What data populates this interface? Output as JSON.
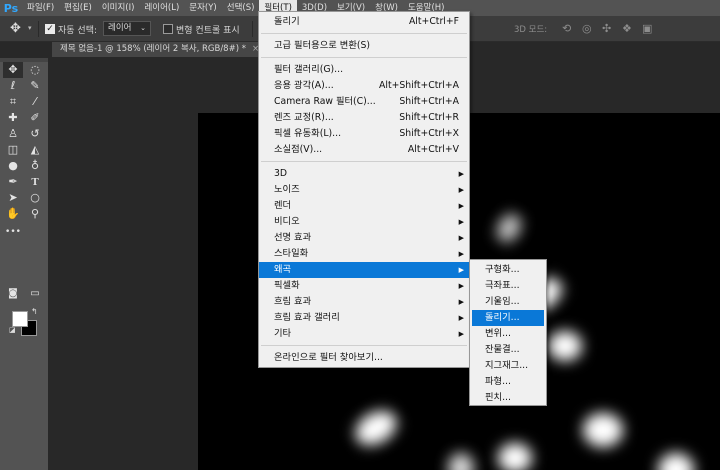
{
  "menubar": {
    "logo": "Ps",
    "items": [
      "파일(F)",
      "편집(E)",
      "이미지(I)",
      "레이어(L)",
      "문자(Y)",
      "선택(S)",
      "필터(T)",
      "3D(D)",
      "보기(V)",
      "창(W)",
      "도움말(H)"
    ]
  },
  "options": {
    "auto_select_label": "자동 선택:",
    "auto_select_checked": true,
    "layer_select_value": "레이어",
    "transform_controls_label": "변형 컨트롤 표시",
    "mode_3d_label": "3D 모드:"
  },
  "document": {
    "tab_title": "제목 없음-1 @ 158% (레이어 2 복사, RGB/8#) *",
    "close_glyph": "×"
  },
  "filter_menu": {
    "groups": [
      [
        {
          "label": "돌리기",
          "shortcut": "Alt+Ctrl+F"
        }
      ],
      [
        {
          "label": "고급 필터용으로 변환(S)",
          "shortcut": ""
        }
      ],
      [
        {
          "label": "필터 갤러리(G)...",
          "shortcut": ""
        },
        {
          "label": "응용 광각(A)...",
          "shortcut": "Alt+Shift+Ctrl+A"
        },
        {
          "label": "Camera Raw 필터(C)...",
          "shortcut": "Shift+Ctrl+A"
        },
        {
          "label": "렌즈 교정(R)...",
          "shortcut": "Shift+Ctrl+R"
        },
        {
          "label": "픽셀 유동화(L)...",
          "shortcut": "Shift+Ctrl+X"
        },
        {
          "label": "소실점(V)...",
          "shortcut": "Alt+Ctrl+V"
        }
      ],
      [
        {
          "label": "3D",
          "submenu": true
        },
        {
          "label": "노이즈",
          "submenu": true
        },
        {
          "label": "렌더",
          "submenu": true
        },
        {
          "label": "비디오",
          "submenu": true
        },
        {
          "label": "선명 효과",
          "submenu": true
        },
        {
          "label": "스타일화",
          "submenu": true
        },
        {
          "label": "왜곡",
          "submenu": true,
          "highlighted": true
        },
        {
          "label": "픽셀화",
          "submenu": true
        },
        {
          "label": "흐림 효과",
          "submenu": true
        },
        {
          "label": "흐림 효과 갤러리",
          "submenu": true
        },
        {
          "label": "기타",
          "submenu": true
        }
      ],
      [
        {
          "label": "온라인으로 필터 찾아보기...",
          "shortcut": ""
        }
      ]
    ]
  },
  "distort_submenu": {
    "items": [
      "구형화...",
      "극좌표...",
      "기울임...",
      "돌리기...",
      "변위...",
      "잔물결...",
      "지그재그...",
      "파형...",
      "핀치..."
    ],
    "highlighted_index": 3
  },
  "colors": {
    "menu_highlight": "#0a78d7",
    "ps_blue": "#31a8ff"
  }
}
